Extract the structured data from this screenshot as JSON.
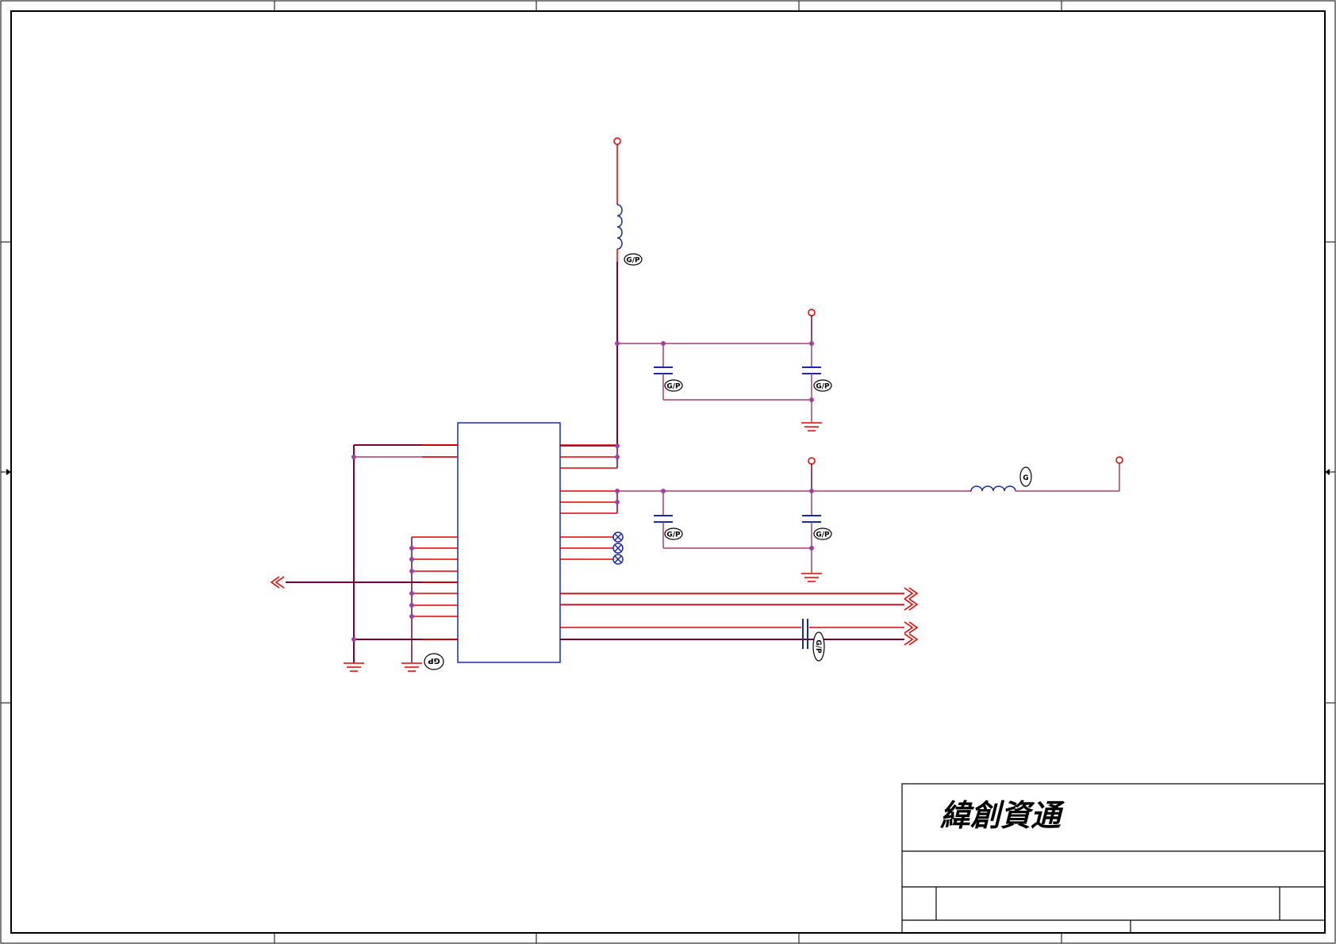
{
  "title_block": {
    "company_logo": "緯創資通"
  },
  "badges": {
    "gp": "G/P",
    "gp_rotated": "GP",
    "g": "G"
  },
  "colors": {
    "border": "#000000",
    "wire": "#7a0030",
    "pin": "#ff0000",
    "junction": "#a040a0",
    "component": "#1a2aa0",
    "ground": "#e00000",
    "power": "#e00000"
  },
  "icons": {
    "power_port": "open-circle",
    "ground": "ground-symbol",
    "off_page": "double-chevron",
    "no_connect": "x-circle"
  }
}
